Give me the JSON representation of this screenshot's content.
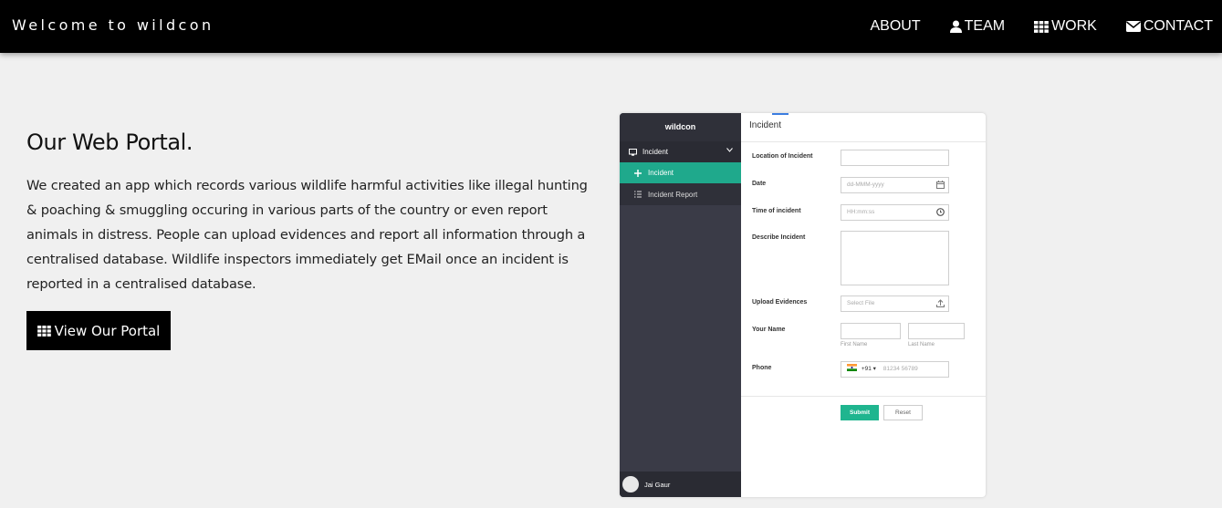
{
  "header": {
    "brand": "Welcome to wildcon",
    "nav": [
      {
        "label": "ABOUT",
        "icon": ""
      },
      {
        "label": "TEAM",
        "icon": "user-icon"
      },
      {
        "label": "WORK",
        "icon": "grid-icon"
      },
      {
        "label": "CONTACT",
        "icon": "envelope-icon"
      }
    ]
  },
  "section": {
    "title": "Our Web Portal.",
    "description": "We created an app which records various wildlife harmful activities like illegal hunting & poaching & smuggling occuring in various parts of the country or even report animals in distress. People can upload evidences and report all information through a centralised database. Wildlife inspectors immediately get EMail once an incident is reported in a centralised database.",
    "button_label": "View Our Portal",
    "button_icon": "grid-icon"
  },
  "portal": {
    "logo": "wildcon",
    "sidebar": {
      "group": "Incident",
      "active_item": "Incident",
      "sub_item": "Incident Report",
      "user": "Jai Gaur"
    },
    "page_title": "Incident",
    "form": {
      "location_label": "Location of Incident",
      "date_label": "Date",
      "date_placeholder": "dd-MMM-yyyy",
      "time_label": "Time of incident",
      "time_placeholder": "HH:mm:ss",
      "describe_label": "Describe Incident",
      "upload_label": "Upload Evidences",
      "upload_placeholder": "Select File",
      "name_label": "Your Name",
      "first_name": "First Name",
      "last_name": "Last Name",
      "phone_label": "Phone",
      "phone_code": "+91",
      "phone_placeholder": "81234 56789",
      "submit": "Submit",
      "reset": "Reset"
    },
    "colors": {
      "accent": "#1fa98c",
      "sidebar": "#3a3b47"
    }
  }
}
